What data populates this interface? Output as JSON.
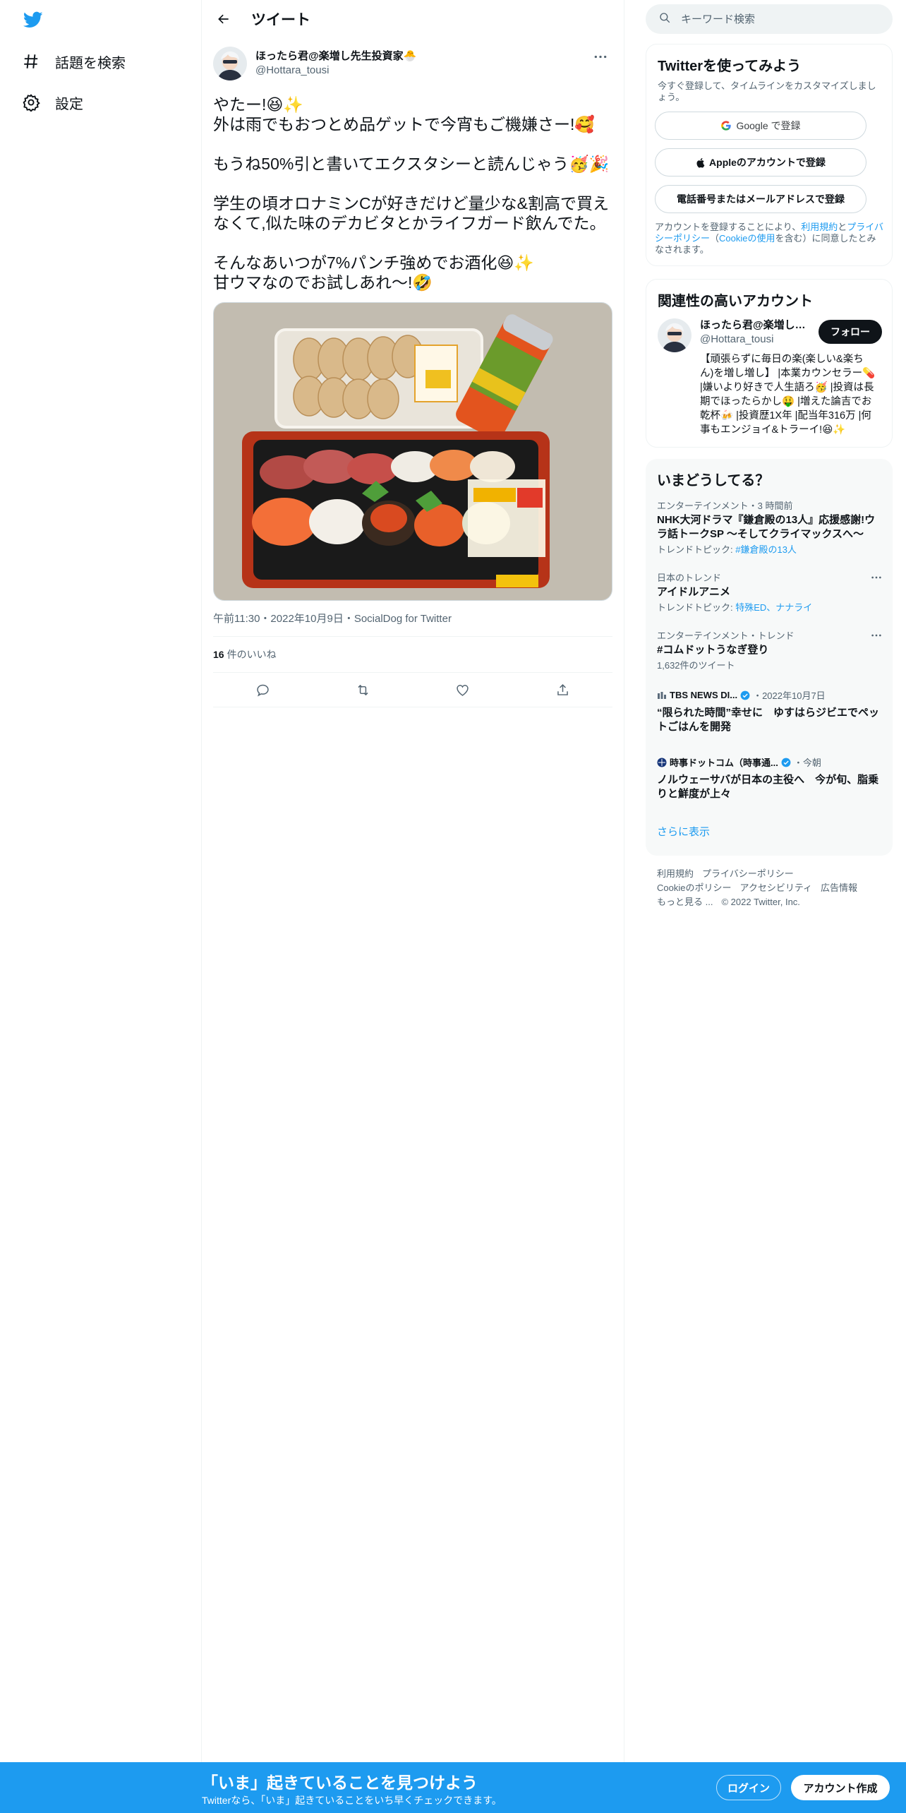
{
  "nav": {
    "logo_icon": "twitter-bird-icon",
    "items": [
      {
        "label": "話題を検索",
        "icon": "hashtag-icon"
      },
      {
        "label": "設定",
        "icon": "gear-icon"
      }
    ]
  },
  "header": {
    "title": "ツイート"
  },
  "tweet": {
    "author_name": "ほったら君@楽増し先生投資家🐣",
    "author_handle": "@Hottara_tousi",
    "lines": [
      "やたー!😆✨",
      "外は雨でもおつとめ品ゲットで今宵もご機嫌さー!🥰",
      "",
      "もうね50%引と書いてエクスタシーと読んじゃう🥳🎉",
      "",
      "学生の頃オロナミンCが好きだけど量少な&割高で買えなくて,似た味のデカビタとかライフガード飲んでた。",
      "",
      "そんなあいつが7%パンチ強めでお酒化😆✨",
      "甘ウマなのでお試しあれ〜!🤣"
    ],
    "meta": "午前11:30・2022年10月9日・SocialDog for Twitter",
    "likes_count": "16",
    "likes_label": "件のいいね"
  },
  "search": {
    "placeholder": "キーワード検索"
  },
  "signup_card": {
    "title": "Twitterを使ってみよう",
    "subtitle": "今すぐ登録して、タイムラインをカスタマイズしましょう。",
    "google_label": "Google で登録",
    "apple_label": "Appleのアカウントで登録",
    "phone_label": "電話番号またはメールアドレスで登録",
    "legal_pre": "アカウントを登録することにより、",
    "legal_terms": "利用規約",
    "legal_and": "と",
    "legal_privacy": "プライバシーポリシー",
    "legal_paren_open": "（",
    "legal_cookie": "Cookieの使用",
    "legal_post": "を含む）に同意したとみなされます。"
  },
  "related": {
    "title": "関連性の高いアカウント",
    "name": "ほったら君@楽増し先生投資家",
    "handle": "@Hottara_tousi",
    "follow_label": "フォロー",
    "bio": "【頑張らずに毎日の楽(楽しい&楽ちん)を増し増し】 |本業カウンセラー💊 |嫌いより好きで人生語ろ🥳 |投資は長期でほったらかし🤑 |増えた論吉でお乾杯🍻 |投資歴1X年 |配当年316万 |何事もエンジョイ&トラーイ!😆✨"
  },
  "trends": {
    "title": "いまどうしてる？",
    "items": [
      {
        "context": "エンターテインメント・3 時間前",
        "title": "NHK大河ドラマ『鎌倉殿の13人』応援感謝!ウラ話トークSP ～そしてクライマックスへ～",
        "sub_label": "トレンドトピック: ",
        "sub_link": "#鎌倉殿の13人"
      },
      {
        "context": "日本のトレンド",
        "title": "アイドルアニメ",
        "sub_label": "トレンドトピック: ",
        "sub_link": "特殊ED、ナナライ"
      },
      {
        "context": "エンターテインメント・トレンド",
        "title": "#コムドットうなぎ登り",
        "sub_label": "1,632件のツイート",
        "sub_link": ""
      }
    ],
    "news": [
      {
        "source": "TBS NEWS DI...",
        "time": "・2022年10月7日",
        "title": "“限られた時間”幸せに　ゆすはらジビエでペットごはんを開発"
      },
      {
        "source": "時事ドットコム（時事通...",
        "time": "・今朝",
        "title": "ノルウェーサバが日本の主役へ　今が旬、脂乗りと鮮度が上々"
      }
    ],
    "show_more": "さらに表示"
  },
  "footer": {
    "links": [
      "利用規約",
      "プライバシーポリシー",
      "Cookieのポリシー",
      "アクセシビリティ",
      "広告情報",
      "もっと見る ..."
    ],
    "copyright": "© 2022 Twitter, Inc."
  },
  "bottom_bar": {
    "title": "「いま」起きていることを見つけよう",
    "subtitle": "Twitterなら、「いま」起きていることをいち早くチェックできます。",
    "login": "ログイン",
    "signup": "アカウント作成"
  },
  "colors": {
    "accent": "#1d9bf0",
    "text": "#0f1419",
    "muted": "#536471",
    "border": "#eff3f4"
  }
}
